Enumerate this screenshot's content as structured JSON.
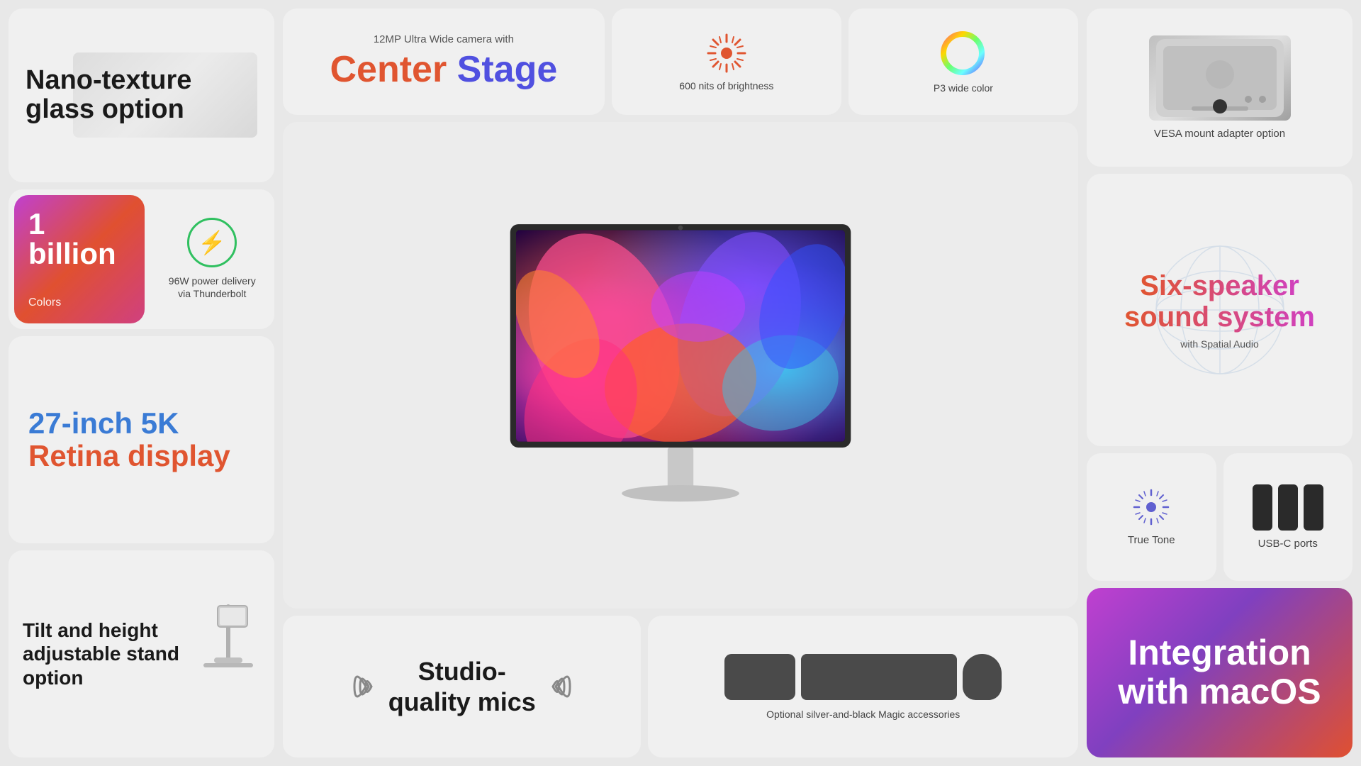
{
  "left": {
    "nano": {
      "title": "Nano-texture glass option"
    },
    "billion": {
      "number": "1 billion",
      "label": "Colors"
    },
    "power": {
      "wattage": "96W power delivery via Thunderbolt"
    },
    "retina": {
      "line1": "27-inch 5K",
      "line2": "Retina display"
    },
    "stand": {
      "title": "Tilt and height adjustable stand option"
    }
  },
  "center": {
    "camera_subtitle": "12MP Ultra Wide camera with",
    "center_stage_label": "Center Stage",
    "center_stage_center": "Center",
    "center_stage_stage": " Stage",
    "brightness_label": "600 nits of brightness",
    "p3_label": "P3 wide color",
    "mics_line1": "Studio-",
    "mics_line2": "quality mics",
    "accessories_label": "Optional silver-and-black Magic accessories"
  },
  "right": {
    "vesa_label": "VESA mount adapter option",
    "six_speaker_line1": "Six-speaker",
    "six_speaker_line2": "sound system",
    "spatial_audio": "with Spatial Audio",
    "true_tone_label": "True Tone",
    "usb_label": "USB-C ports",
    "macos_line1": "Integration",
    "macos_line2": "with macOS"
  }
}
